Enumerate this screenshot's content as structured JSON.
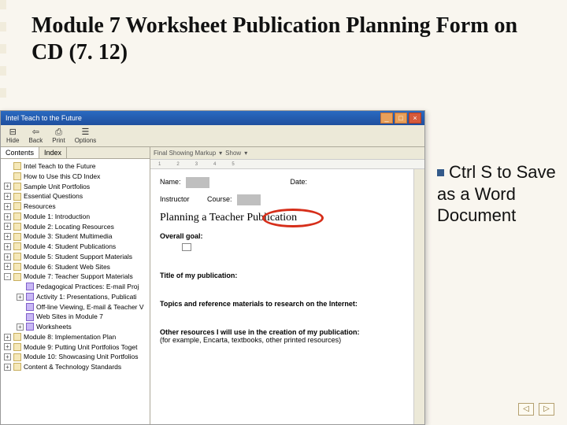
{
  "slide": {
    "title": "Module 7 Worksheet Publication Planning Form on CD (7. 12)"
  },
  "note": {
    "text": "Ctrl S to Save as a Word Document"
  },
  "window": {
    "title": "Intel Teach to the Future",
    "toolbar": {
      "hide": "Hide",
      "back": "Back",
      "print": "Print",
      "options": "Options"
    },
    "tabs": {
      "contents": "Contents",
      "index": "Index"
    },
    "doc_toolbar": {
      "markup": "Final Showing Markup",
      "show": "Show"
    },
    "tree": [
      {
        "label": "Intel Teach to the Future",
        "level": 0,
        "exp": ""
      },
      {
        "label": "How to Use this CD Index",
        "level": 0,
        "exp": ""
      },
      {
        "label": "Sample Unit Portfolios",
        "level": 0,
        "exp": "+"
      },
      {
        "label": "Essential Questions",
        "level": 0,
        "exp": "+"
      },
      {
        "label": "Resources",
        "level": 0,
        "exp": "+"
      },
      {
        "label": "Module 1: Introduction",
        "level": 0,
        "exp": "+"
      },
      {
        "label": "Module 2: Locating Resources",
        "level": 0,
        "exp": "+"
      },
      {
        "label": "Module 3: Student Multimedia",
        "level": 0,
        "exp": "+"
      },
      {
        "label": "Module 4: Student Publications",
        "level": 0,
        "exp": "+"
      },
      {
        "label": "Module 5: Student Support Materials",
        "level": 0,
        "exp": "+"
      },
      {
        "label": "Module 6: Student Web Sites",
        "level": 0,
        "exp": "+"
      },
      {
        "label": "Module 7: Teacher Support Materials",
        "level": 0,
        "exp": "-"
      },
      {
        "label": "Pedagogical Practices: E-mail Proj",
        "level": 1,
        "exp": ""
      },
      {
        "label": "Activity 1: Presentations, Publicati",
        "level": 1,
        "exp": "+"
      },
      {
        "label": "Off-line Viewing, E-mail & Teacher V",
        "level": 1,
        "exp": ""
      },
      {
        "label": "Web Sites in Module 7",
        "level": 1,
        "exp": ""
      },
      {
        "label": "Worksheets",
        "level": 1,
        "exp": "+"
      },
      {
        "label": "Module 8: Implementation Plan",
        "level": 0,
        "exp": "+"
      },
      {
        "label": "Module 9: Putting Unit Portfolios Toget",
        "level": 0,
        "exp": "+"
      },
      {
        "label": "Module 10: Showcasing Unit Portfolios",
        "level": 0,
        "exp": "+"
      },
      {
        "label": "Content & Technology Standards",
        "level": 0,
        "exp": "+"
      }
    ]
  },
  "document": {
    "fields": {
      "name": "Name:",
      "date": "Date:",
      "instructor": "Instructor",
      "course": "Course:"
    },
    "heading_a": "Planning a Teacher",
    "heading_b": "Publication",
    "sections": {
      "overall": "Overall goal:",
      "title": "Title of my publication:",
      "topics": "Topics and reference materials to research on the Internet:",
      "other_a": "Other resources I will use in the creation of my publication:",
      "other_b": "(for example, Encarta, textbooks, other printed resources)"
    }
  }
}
